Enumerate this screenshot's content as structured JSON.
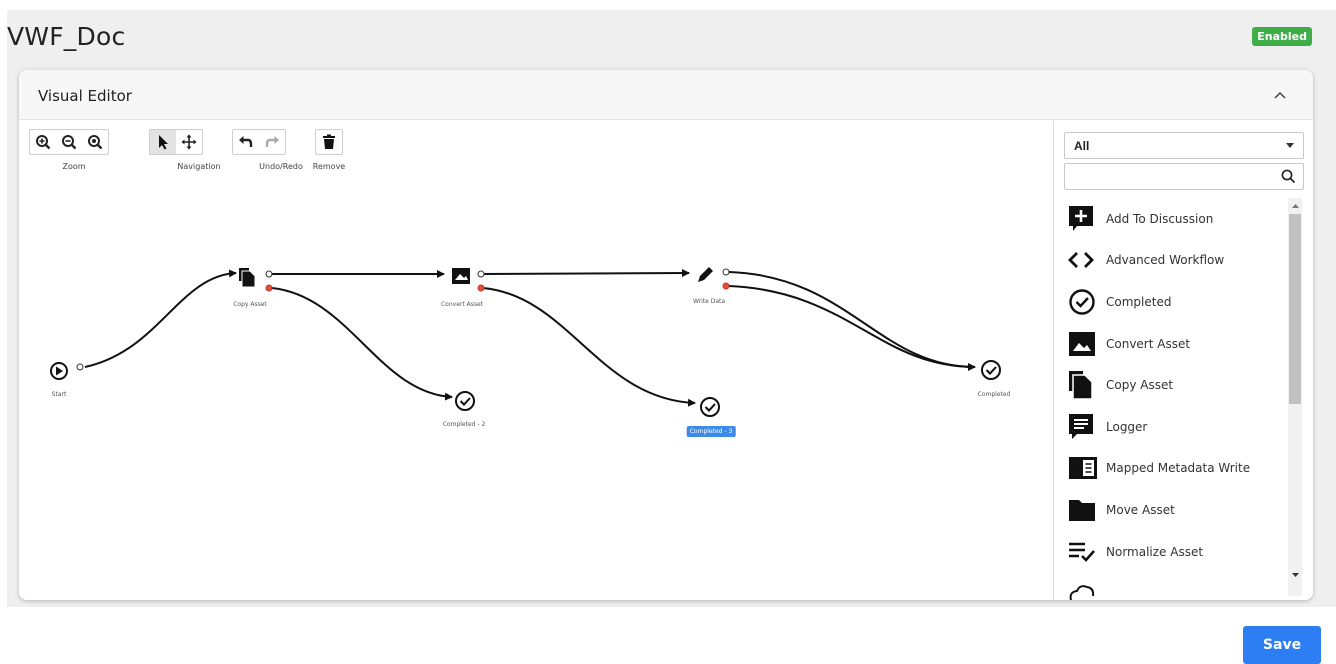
{
  "page": {
    "title": "VWF_Doc",
    "status": "Enabled"
  },
  "editor": {
    "title": "Visual Editor",
    "toolbar": {
      "zoom_label": "Zoom",
      "navigation_label": "Navigation",
      "undo_redo_label": "Undo/Redo",
      "remove_label": "Remove"
    }
  },
  "workflow": {
    "nodes": [
      {
        "id": "start",
        "label": "Start",
        "icon": "play-circle-icon"
      },
      {
        "id": "copy",
        "label": "Copy Asset",
        "icon": "copy-asset-icon"
      },
      {
        "id": "convert",
        "label": "Convert Asset",
        "icon": "convert-asset-icon"
      },
      {
        "id": "write",
        "label": "Write Data",
        "icon": "pencil-icon"
      },
      {
        "id": "completed2",
        "label": "Completed - 2",
        "icon": "check-circle-icon"
      },
      {
        "id": "completed3",
        "label": "Completed - 3",
        "icon": "check-circle-icon",
        "selected": true
      },
      {
        "id": "completed",
        "label": "Completed",
        "icon": "check-circle-icon"
      }
    ]
  },
  "palette": {
    "filter_value": "All",
    "search_placeholder": "",
    "items": [
      {
        "label": "Add To Discussion",
        "icon": "add-discussion-icon"
      },
      {
        "label": "Advanced Workflow",
        "icon": "code-icon"
      },
      {
        "label": "Completed",
        "icon": "check-circle-icon"
      },
      {
        "label": "Convert Asset",
        "icon": "image-icon"
      },
      {
        "label": "Copy Asset",
        "icon": "copy-icon"
      },
      {
        "label": "Logger",
        "icon": "chat-lines-icon"
      },
      {
        "label": "Mapped Metadata Write",
        "icon": "metadata-write-icon"
      },
      {
        "label": "Move Asset",
        "icon": "folder-icon"
      },
      {
        "label": "Normalize Asset",
        "icon": "list-check-icon"
      }
    ]
  },
  "actions": {
    "save_label": "Save"
  },
  "colors": {
    "accent": "#2d7ef2",
    "enabled": "#3fae49",
    "selected_label": "#3d8be8",
    "fail_port": "#e74c3c"
  }
}
